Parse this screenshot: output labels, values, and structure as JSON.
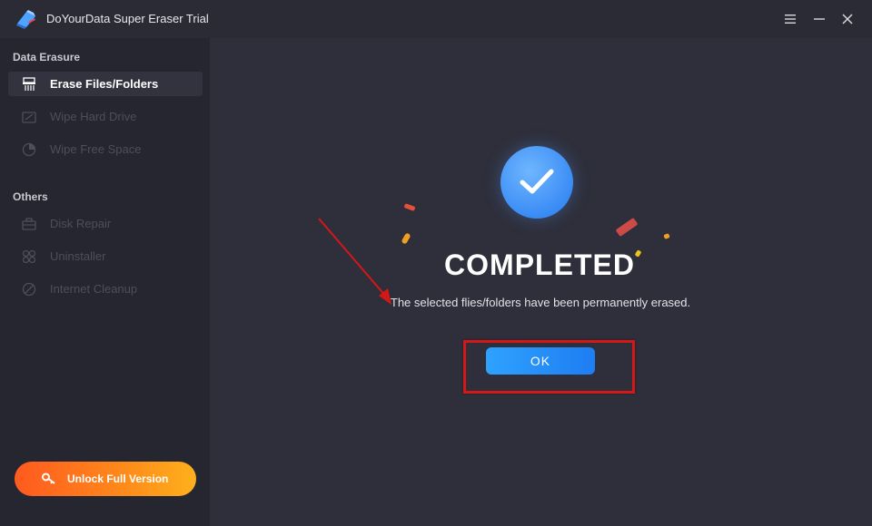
{
  "app": {
    "title": "DoYourData Super Eraser Trial",
    "logo_icon": "eraser-logo-icon"
  },
  "window_controls": {
    "menu_icon": "hamburger-menu-icon",
    "minimize_icon": "minimize-icon",
    "close_icon": "close-icon"
  },
  "sidebar": {
    "sections": [
      {
        "label": "Data Erasure",
        "items": [
          {
            "label": "Erase Files/Folders",
            "icon": "shredder-icon",
            "state": "active"
          },
          {
            "label": "Wipe Hard Drive",
            "icon": "hard-drive-icon",
            "state": "disabled"
          },
          {
            "label": "Wipe Free Space",
            "icon": "pie-chart-icon",
            "state": "disabled"
          }
        ]
      },
      {
        "label": "Others",
        "items": [
          {
            "label": "Disk Repair",
            "icon": "toolbox-icon",
            "state": "disabled"
          },
          {
            "label": "Uninstaller",
            "icon": "grid-apps-icon",
            "state": "disabled"
          },
          {
            "label": "Internet Cleanup",
            "icon": "globe-broom-icon",
            "state": "disabled"
          }
        ]
      }
    ],
    "unlock_button": {
      "label": "Unlock Full Version",
      "icon": "key-icon"
    }
  },
  "main": {
    "status_icon": "check-mark-icon",
    "heading": "COMPLETED",
    "message": "The selected flies/folders have been permanently erased.",
    "ok_button": "OK"
  },
  "colors": {
    "accent_blue": "#2a8cf7",
    "unlock_orange": "#ff7a1c",
    "annotation_red": "#d41818",
    "background": "#2f2f3b",
    "sidebar": "#262630"
  }
}
